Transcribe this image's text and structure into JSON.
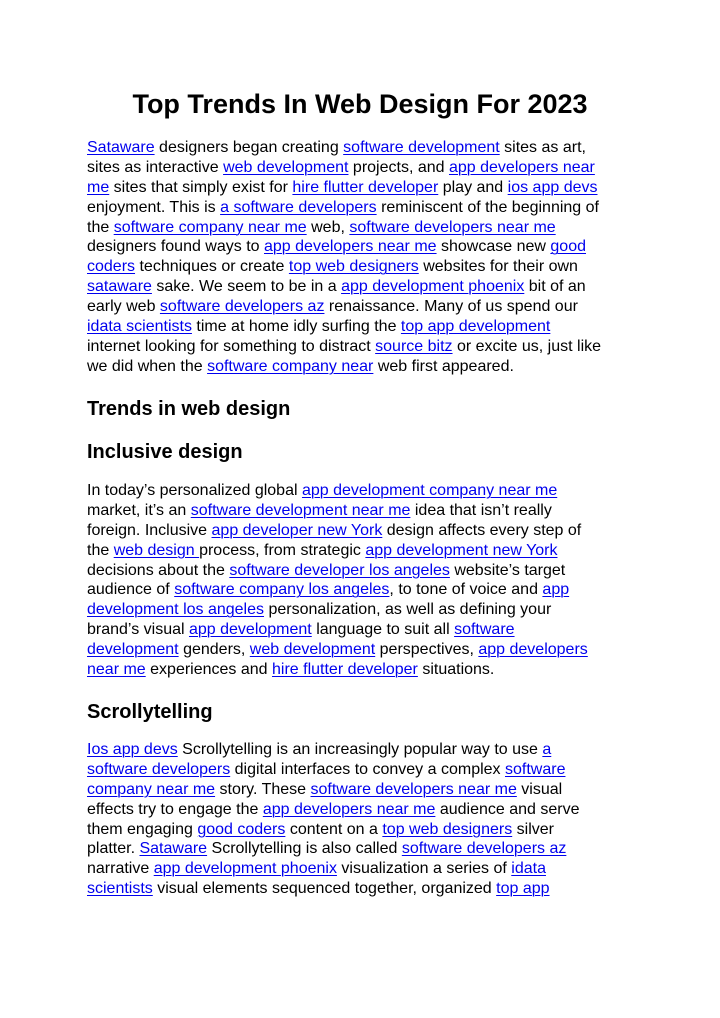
{
  "document": {
    "title": "Top Trends In Web Design For 2023",
    "link_color": "#0000ee",
    "sections": [
      {
        "id": "p1",
        "type": "paragraph",
        "lines": [
          [
            {
              "t": "link",
              "v": "Sataware"
            },
            {
              "t": "text",
              "v": " designers began creating "
            },
            {
              "t": "link",
              "v": "software development"
            },
            {
              "t": "text",
              "v": " sites as art,"
            }
          ],
          [
            {
              "t": "text",
              "v": "sites as interactive "
            },
            {
              "t": "link",
              "v": "web development"
            },
            {
              "t": "text",
              "v": " projects, and "
            },
            {
              "t": "link",
              "v": "app developers near"
            }
          ],
          [
            {
              "t": "link",
              "v": "me"
            },
            {
              "t": "text",
              "v": " sites that simply exist for "
            },
            {
              "t": "link",
              "v": "hire flutter developer"
            },
            {
              "t": "text",
              "v": " play and "
            },
            {
              "t": "link",
              "v": "ios app devs"
            }
          ],
          [
            {
              "t": "text",
              "v": "enjoyment. This is "
            },
            {
              "t": "link",
              "v": "a software developers"
            },
            {
              "t": "text",
              "v": " reminiscent of the beginning of"
            }
          ],
          [
            {
              "t": "text",
              "v": "the "
            },
            {
              "t": "link",
              "v": "software company near me"
            },
            {
              "t": "text",
              "v": " web, "
            },
            {
              "t": "link",
              "v": "software developers near me"
            }
          ],
          [
            {
              "t": "text",
              "v": "designers found ways to "
            },
            {
              "t": "link",
              "v": "app developers near me"
            },
            {
              "t": "text",
              "v": " showcase new "
            },
            {
              "t": "link",
              "v": "good"
            }
          ],
          [
            {
              "t": "link",
              "v": "coders"
            },
            {
              "t": "text",
              "v": " techniques or create "
            },
            {
              "t": "link",
              "v": "top web designers"
            },
            {
              "t": "text",
              "v": " websites for their own"
            }
          ],
          [
            {
              "t": "link",
              "v": "sataware"
            },
            {
              "t": "text",
              "v": " sake. We seem to be in a "
            },
            {
              "t": "link",
              "v": "app development phoenix"
            },
            {
              "t": "text",
              "v": " bit of an"
            }
          ],
          [
            {
              "t": "text",
              "v": "early web "
            },
            {
              "t": "link",
              "v": "software developers az"
            },
            {
              "t": "text",
              "v": " renaissance. Many of us spend our"
            }
          ],
          [
            {
              "t": "link",
              "v": "idata scientists"
            },
            {
              "t": "text",
              "v": " time at home idly surfing the "
            },
            {
              "t": "link",
              "v": "top app development"
            }
          ],
          [
            {
              "t": "text",
              "v": "internet looking for something to distract "
            },
            {
              "t": "link",
              "v": "source bitz"
            },
            {
              "t": "text",
              "v": " or excite us, just like"
            }
          ],
          [
            {
              "t": "text",
              "v": "we did when the "
            },
            {
              "t": "link",
              "v": "software company near"
            },
            {
              "t": "text",
              "v": " web first appeared."
            }
          ]
        ]
      },
      {
        "id": "p2",
        "type": "paragraph",
        "lines": [
          [
            {
              "t": "text",
              "v": "In today’s personalized global "
            },
            {
              "t": "link",
              "v": "app development company near me"
            }
          ],
          [
            {
              "t": "text",
              "v": "market, it’s an "
            },
            {
              "t": "link",
              "v": "software development near me"
            },
            {
              "t": "text",
              "v": " idea that isn’t really"
            }
          ],
          [
            {
              "t": "text",
              "v": "foreign. Inclusive "
            },
            {
              "t": "link",
              "v": "app developer new York"
            },
            {
              "t": "text",
              "v": " design affects every step of"
            }
          ],
          [
            {
              "t": "text",
              "v": "the "
            },
            {
              "t": "link",
              "v": "web design "
            },
            {
              "t": "text",
              "v": "process, from strategic "
            },
            {
              "t": "link",
              "v": "app development new York"
            }
          ],
          [
            {
              "t": "text",
              "v": "decisions about the "
            },
            {
              "t": "link",
              "v": "software developer los angeles"
            },
            {
              "t": "text",
              "v": " website’s target"
            }
          ],
          [
            {
              "t": "text",
              "v": "audience of "
            },
            {
              "t": "link",
              "v": "software company los angeles"
            },
            {
              "t": "text",
              "v": ", to tone of voice and "
            },
            {
              "t": "link",
              "v": "app"
            }
          ],
          [
            {
              "t": "link",
              "v": "development los angeles"
            },
            {
              "t": "text",
              "v": " personalization, as well as defining your"
            }
          ],
          [
            {
              "t": "text",
              "v": "brand’s visual "
            },
            {
              "t": "link",
              "v": "app development"
            },
            {
              "t": "text",
              "v": " language to suit all "
            },
            {
              "t": "link",
              "v": "software"
            }
          ],
          [
            {
              "t": "link",
              "v": "development"
            },
            {
              "t": "text",
              "v": " genders, "
            },
            {
              "t": "link",
              "v": "web development"
            },
            {
              "t": "text",
              "v": " perspectives, "
            },
            {
              "t": "link",
              "v": "app developers"
            }
          ],
          [
            {
              "t": "link",
              "v": "near me"
            },
            {
              "t": "text",
              "v": " experiences and "
            },
            {
              "t": "link",
              "v": "hire flutter developer"
            },
            {
              "t": "text",
              "v": " situations."
            }
          ]
        ]
      },
      {
        "id": "p3",
        "type": "paragraph",
        "lines": [
          [
            {
              "t": "link",
              "v": "Ios app devs"
            },
            {
              "t": "text",
              "v": " Scrollytelling is an increasingly popular way to use "
            },
            {
              "t": "link",
              "v": "a"
            }
          ],
          [
            {
              "t": "link",
              "v": "software developers"
            },
            {
              "t": "text",
              "v": " digital interfaces to convey a complex "
            },
            {
              "t": "link",
              "v": "software"
            }
          ],
          [
            {
              "t": "link",
              "v": "company near me"
            },
            {
              "t": "text",
              "v": " story. These "
            },
            {
              "t": "link",
              "v": "software developers near me"
            },
            {
              "t": "text",
              "v": " visual"
            }
          ],
          [
            {
              "t": "text",
              "v": "effects try to engage the "
            },
            {
              "t": "link",
              "v": "app developers near me"
            },
            {
              "t": "text",
              "v": " audience and serve"
            }
          ],
          [
            {
              "t": "text",
              "v": "them engaging "
            },
            {
              "t": "link",
              "v": "good coders"
            },
            {
              "t": "text",
              "v": " content on a "
            },
            {
              "t": "link",
              "v": "top web designers"
            },
            {
              "t": "text",
              "v": " silver"
            }
          ],
          [
            {
              "t": "text",
              "v": "platter. "
            },
            {
              "t": "link",
              "v": "Sataware"
            },
            {
              "t": "text",
              "v": " Scrollytelling is also called "
            },
            {
              "t": "link",
              "v": "software developers az"
            }
          ],
          [
            {
              "t": "text",
              "v": "narrative "
            },
            {
              "t": "link",
              "v": "app development phoenix"
            },
            {
              "t": "text",
              "v": " visualization a series of "
            },
            {
              "t": "link",
              "v": "idata"
            }
          ],
          [
            {
              "t": "link",
              "v": "scientists"
            },
            {
              "t": "text",
              "v": " visual elements sequenced together, organized "
            },
            {
              "t": "link",
              "v": "top app"
            }
          ]
        ]
      }
    ],
    "headings": {
      "trends": "Trends in web design",
      "inclusive": "Inclusive design",
      "scrollytelling": "Scrollytelling"
    }
  }
}
